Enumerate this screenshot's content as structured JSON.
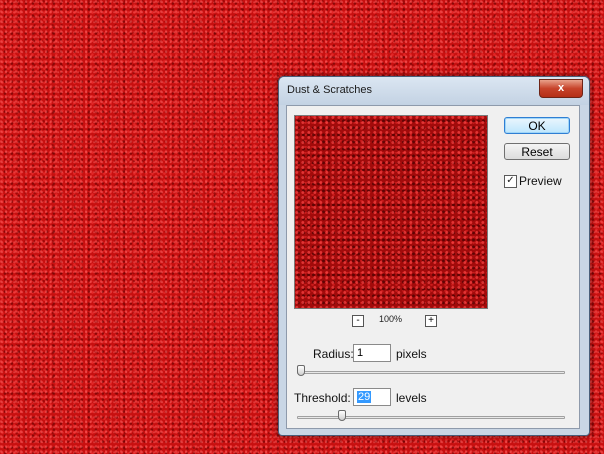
{
  "dialog": {
    "title": "Dust & Scratches",
    "close_symbol": "x",
    "ok_label": "OK",
    "reset_label": "Reset",
    "preview": {
      "label": "Preview",
      "checked": true,
      "check_symbol": "✓"
    },
    "zoom": {
      "level": "100%",
      "minus": "-",
      "plus": "+"
    },
    "radius": {
      "label": "Radius:",
      "value": "1",
      "unit": "pixels"
    },
    "threshold": {
      "label": "Threshold:",
      "value": "29",
      "unit": "levels"
    }
  },
  "colors": {
    "canvas_red": "#c81010",
    "dialog_frame": "#c9d6e5",
    "close_red": "#c7432a",
    "default_button_border": "#2f7ed3"
  },
  "icons": [
    "close-icon",
    "zoom-out-icon",
    "zoom-in-icon",
    "checkbox-checked-icon"
  ]
}
